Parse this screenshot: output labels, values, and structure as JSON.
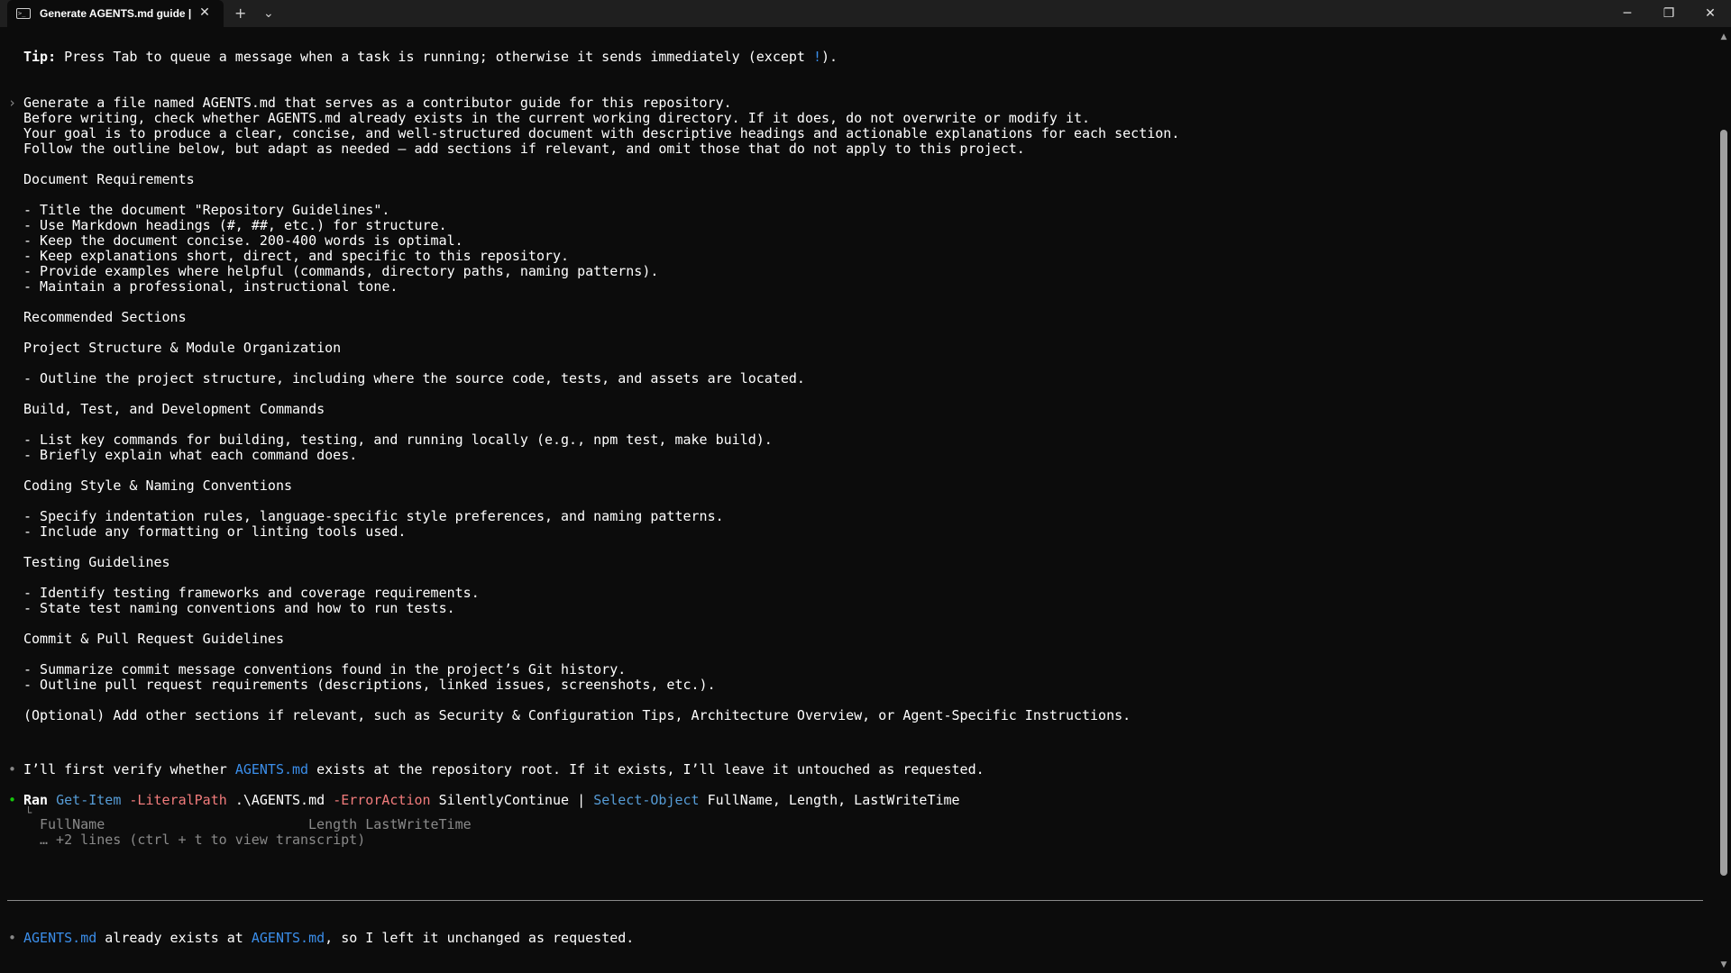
{
  "window": {
    "tab_title": "Generate AGENTS.md guide |",
    "tab_icon": "terminal-icon",
    "new_tab": "+",
    "dropdown": "⌄",
    "minimize": "─",
    "restore": "❐",
    "close": "✕"
  },
  "tip": {
    "label": "Tip:",
    "text": " Press Tab to queue a message when a task is running; otherwise it sends immediately (except ",
    "key": "!",
    "end": ")."
  },
  "prompt": {
    "marker": "›",
    "lines": [
      "Generate a file named AGENTS.md that serves as a contributor guide for this repository.",
      "Before writing, check whether AGENTS.md already exists in the current working directory. If it does, do not overwrite or modify it.",
      "Your goal is to produce a clear, concise, and well-structured document with descriptive headings and actionable explanations for each section.",
      "Follow the outline below, but adapt as needed — add sections if relevant, and omit those that do not apply to this project.",
      "",
      "Document Requirements",
      "",
      "- Title the document \"Repository Guidelines\".",
      "- Use Markdown headings (#, ##, etc.) for structure.",
      "- Keep the document concise. 200-400 words is optimal.",
      "- Keep explanations short, direct, and specific to this repository.",
      "- Provide examples where helpful (commands, directory paths, naming patterns).",
      "- Maintain a professional, instructional tone.",
      "",
      "Recommended Sections",
      "",
      "Project Structure & Module Organization",
      "",
      "- Outline the project structure, including where the source code, tests, and assets are located.",
      "",
      "Build, Test, and Development Commands",
      "",
      "- List key commands for building, testing, and running locally (e.g., npm test, make build).",
      "- Briefly explain what each command does.",
      "",
      "Coding Style & Naming Conventions",
      "",
      "- Specify indentation rules, language-specific style preferences, and naming patterns.",
      "- Include any formatting or linting tools used.",
      "",
      "Testing Guidelines",
      "",
      "- Identify testing frameworks and coverage requirements.",
      "- State test naming conventions and how to run tests.",
      "",
      "Commit & Pull Request Guidelines",
      "",
      "- Summarize commit message conventions found in the project’s Git history.",
      "- Outline pull request requirements (descriptions, linked issues, screenshots, etc.).",
      "",
      "(Optional) Add other sections if relevant, such as Security & Configuration Tips, Architecture Overview, or Agent-Specific Instructions."
    ]
  },
  "reply1": {
    "bullet": "•",
    "pre": "I’ll first verify whether ",
    "link": "AGENTS.md",
    "post": " exists at the repository root. If it exists, I’ll leave it untouched as requested."
  },
  "command": {
    "bullet": "•",
    "ran": "Ran",
    "cmd1": "Get-Item",
    "param1": "-LiteralPath",
    "arg1": ".\\AGENTS.md",
    "param2": "-ErrorAction",
    "arg2": "SilentlyContinue",
    "pipe": "|",
    "cmd2": "Select-Object",
    "arg3": "FullName, Length, LastWriteTime",
    "tree": "└",
    "output_header": "FullName                         Length LastWriteTime",
    "output_more": "… +2 lines (ctrl + t to view transcript)"
  },
  "final": {
    "bullet": "•",
    "link1": "AGENTS.md",
    "mid": " already exists at ",
    "link2": "AGENTS.md",
    "end": ", so I left it unchanged as requested."
  },
  "scrollbar": {
    "up": "▲",
    "down": "▼"
  },
  "colors": {
    "background": "#0c0c0c",
    "link": "#3b8eea",
    "command": "#569cd6",
    "param": "#f27c7c",
    "success_bullet": "#16c60c"
  }
}
